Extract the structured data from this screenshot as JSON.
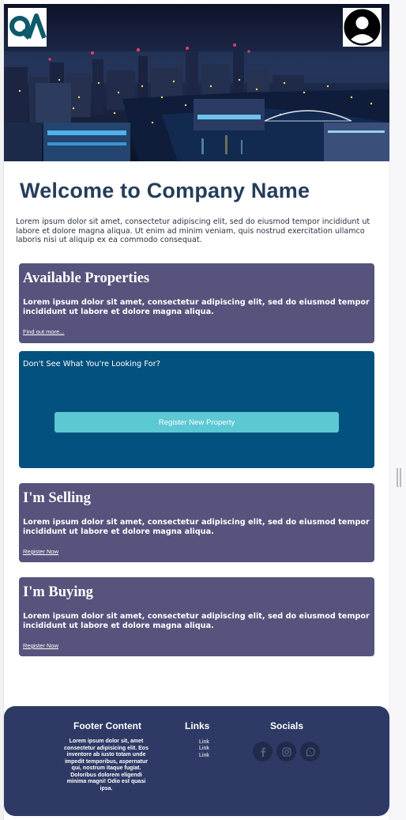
{
  "header": {
    "logo_text": "QA",
    "logo_color": "#0d5a6a",
    "avatar_icon": "user-circle-icon"
  },
  "welcome": {
    "title": "Welcome to Company Name",
    "intro": "Lorem ipsum dolor sit amet, consectetur adipiscing elit, sed do eiusmod tempor incididunt ut labore et dolore magna aliqua. Ut enim ad minim veniam, quis nostrud exercitation ullamco laboris nisi ut aliquip ex ea commodo consequat."
  },
  "cards": {
    "available": {
      "title": "Available Properties",
      "text": "Lorem ipsum dolor sit amet, consectetur adipiscing elit, sed do eiusmod tempor incididunt ut labore et dolore magna aliqua.",
      "link": "Find out more..."
    },
    "register": {
      "heading": "Don't See What You're Looking For?",
      "button": "Register New Property"
    },
    "selling": {
      "title": "I'm Selling",
      "text": "Lorem ipsum dolor sit amet, consectetur adipiscing elit, sed do eiusmod tempor incididunt ut labore et dolore magna aliqua.",
      "link": "Register Now"
    },
    "buying": {
      "title": "I'm Buying",
      "text": "Lorem ipsum dolor sit amet, consectetur adipiscing elit, sed do eiusmod tempor incididunt ut labore et dolore magna aliqua.",
      "link": "Register Now"
    }
  },
  "footer": {
    "content_heading": "Footer Content",
    "content_text": "Lorem ipsum dolor sit, amet consectetur adipisicing elit. Eos inventore ab iusto totam unde impedit temporibus, aspernatur qui, nostrum itaque fugiat. Doloribus dolorem eligendi minima magni! Odio est quasi ipsa.",
    "links_heading": "Links",
    "links": [
      "Link",
      "Link",
      "Link"
    ],
    "socials_heading": "Socials",
    "socials": [
      "facebook-icon",
      "instagram-icon",
      "whatsapp-icon"
    ]
  },
  "colors": {
    "title": "#253d5b",
    "card": "#56537c",
    "cta_card": "#03517e",
    "cta_button": "#5cc8d3",
    "footer": "#2e3a65"
  }
}
